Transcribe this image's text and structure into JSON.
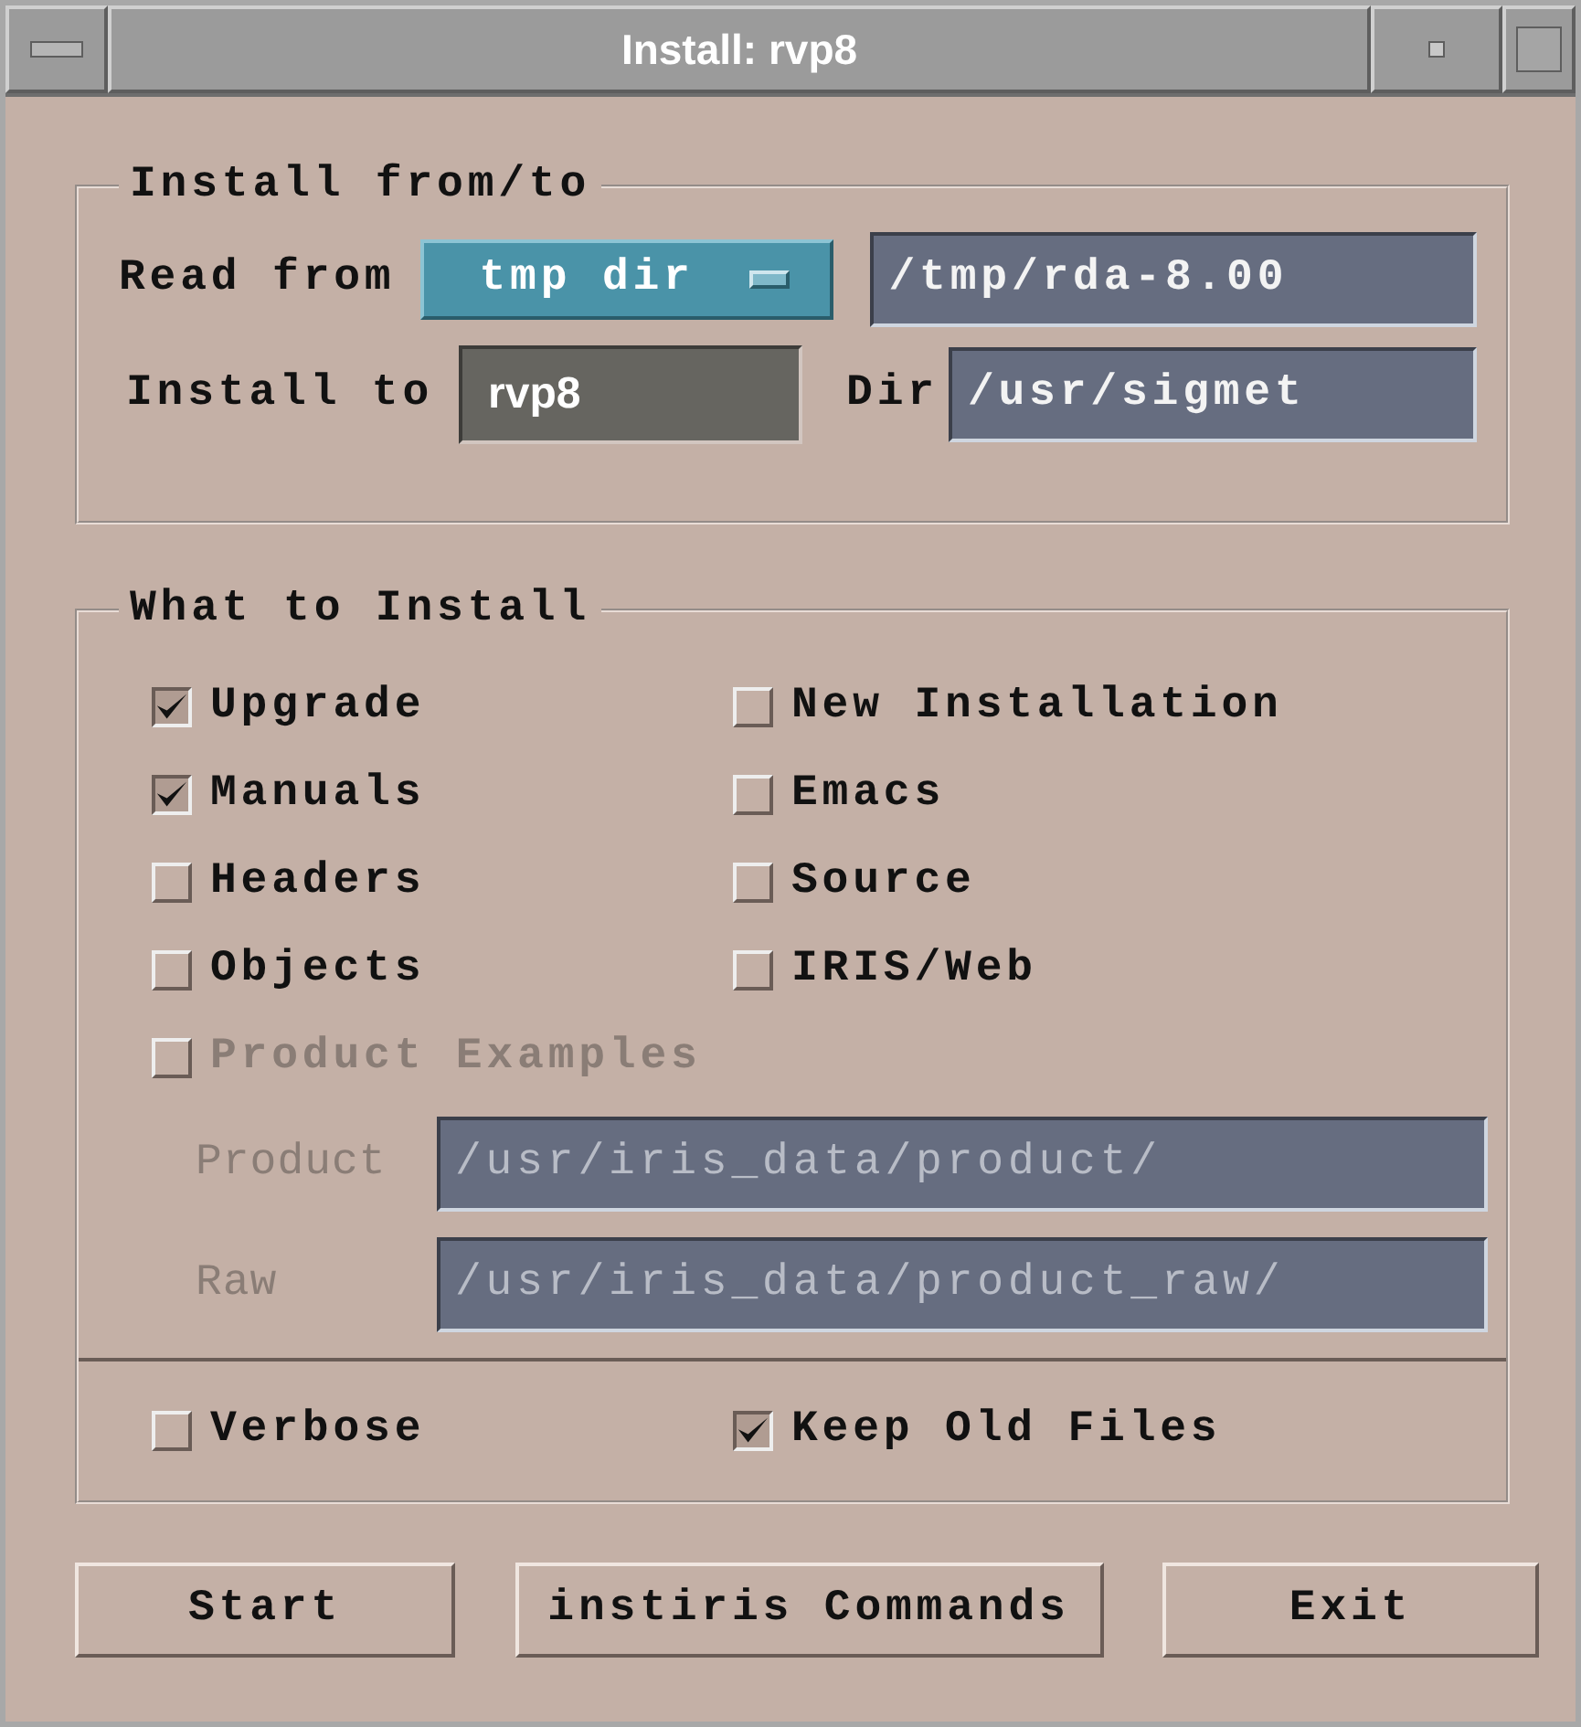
{
  "window": {
    "title": "Install: rvp8"
  },
  "install_from_to": {
    "legend": "Install from/to",
    "read_from_label": "Read from",
    "source_menu": "tmp dir",
    "source_path": "/tmp/rda-8.00",
    "install_to_label": "Install to",
    "target": "rvp8",
    "dir_label": "Dir",
    "dir_path": "/usr/sigmet"
  },
  "what_to_install": {
    "legend": "What to Install",
    "options": [
      {
        "label": "Upgrade",
        "checked": true,
        "disabled": false
      },
      {
        "label": "New Installation",
        "checked": false,
        "disabled": false
      },
      {
        "label": "Manuals",
        "checked": true,
        "disabled": false
      },
      {
        "label": "Emacs",
        "checked": false,
        "disabled": false
      },
      {
        "label": "Headers",
        "checked": false,
        "disabled": false
      },
      {
        "label": "Source",
        "checked": false,
        "disabled": false
      },
      {
        "label": "Objects",
        "checked": false,
        "disabled": false
      },
      {
        "label": "IRIS/Web",
        "checked": false,
        "disabled": false
      },
      {
        "label": "Product Examples",
        "checked": false,
        "disabled": true
      }
    ],
    "paths": [
      {
        "label": "Product",
        "value": "/usr/iris_data/product/",
        "disabled": true
      },
      {
        "label": "Raw",
        "value": "/usr/iris_data/product_raw/",
        "disabled": true
      }
    ],
    "flags": [
      {
        "label": "Verbose",
        "checked": false
      },
      {
        "label": "Keep Old Files",
        "checked": true
      }
    ]
  },
  "buttons": [
    "Start",
    "instiris Commands",
    "Exit"
  ]
}
